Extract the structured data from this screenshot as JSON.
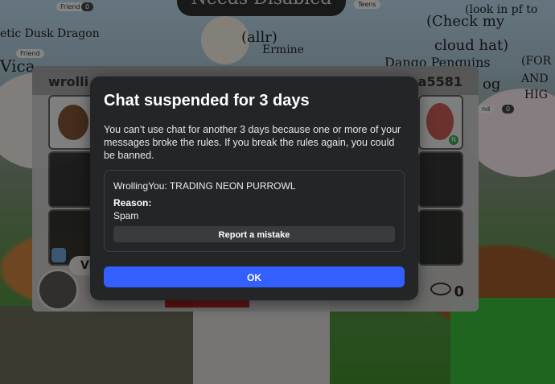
{
  "background": {
    "banner": "Needs Disabled",
    "labels": [
      {
        "text": "etic Dusk Dragon"
      },
      {
        "text": "(allr)"
      },
      {
        "text": "Ermine"
      },
      {
        "text": "(Check my"
      },
      {
        "text": "cloud hat)"
      },
      {
        "text": "(look in pf to"
      },
      {
        "text": "Dango Penguins"
      },
      {
        "text": "og"
      },
      {
        "text": "(FOR"
      },
      {
        "text": "AND"
      },
      {
        "text": "HIG"
      },
      {
        "text": "Vica"
      }
    ],
    "pills": [
      "Friend",
      "Friend",
      "Teens",
      "nd"
    ],
    "pill_counts": [
      "0",
      "0"
    ]
  },
  "trade": {
    "left_user": "wrolli",
    "right_user": "a5581",
    "view_label": "Vie",
    "viewer_count": "0",
    "badge": "N"
  },
  "modal": {
    "title": "Chat suspended for 3 days",
    "body": "You can’t use chat for another 3 days because one or more of your messages broke the rules. If you break the rules again, you could be banned.",
    "message": "WrollingYou: TRADING NEON PURROWL",
    "reason_label": "Reason:",
    "reason_value": "Spam",
    "report_button": "Report a mistake",
    "ok_button": "OK"
  },
  "colors": {
    "modal_bg": "#232527",
    "primary_button": "#335fff",
    "secondary_button": "#393b3d"
  }
}
